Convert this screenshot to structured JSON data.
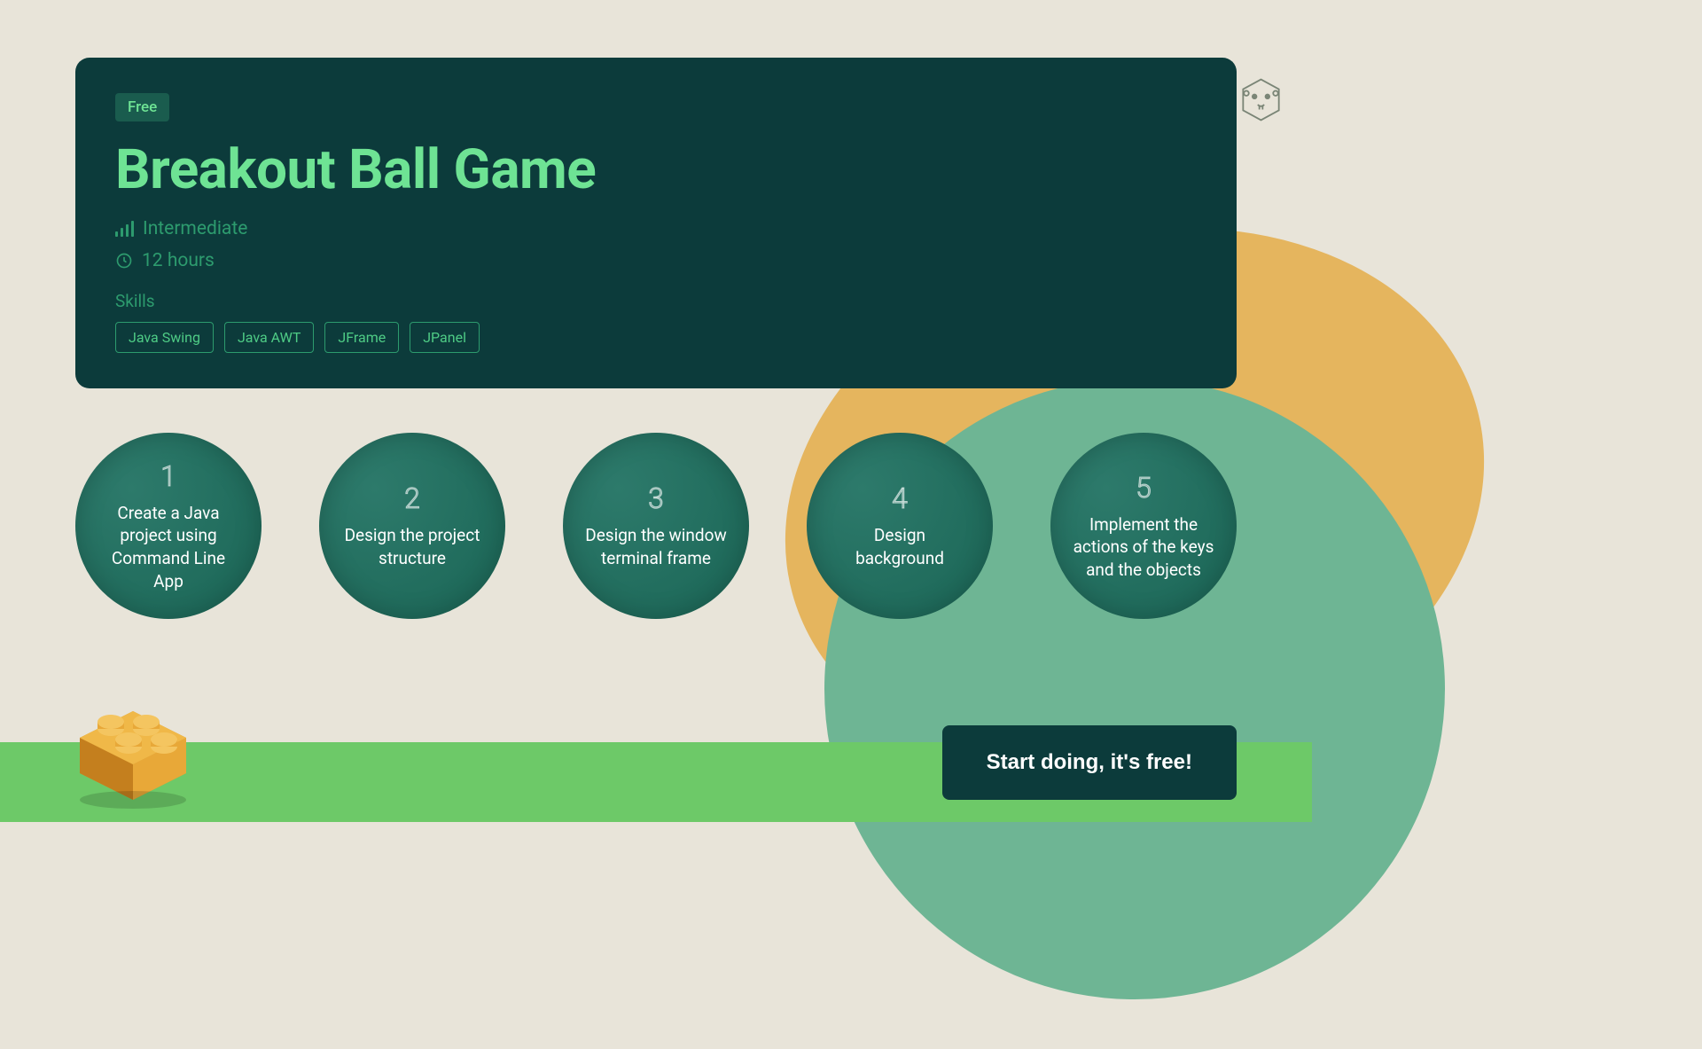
{
  "header": {
    "badge": "Free",
    "title": "Breakout Ball Game",
    "level": "Intermediate",
    "duration": "12 hours",
    "skills_label": "Skills",
    "skills": [
      "Java Swing",
      "Java AWT",
      "JFrame",
      "JPanel"
    ]
  },
  "steps": [
    {
      "number": "1",
      "text": "Create a Java project using Command Line App"
    },
    {
      "number": "2",
      "text": "Design the project structure"
    },
    {
      "number": "3",
      "text": "Design the window terminal frame"
    },
    {
      "number": "4",
      "text": "Design background"
    },
    {
      "number": "5",
      "text": "Implement the actions of the keys and the objects"
    }
  ],
  "cta": {
    "label": "Start doing, it's free!"
  }
}
